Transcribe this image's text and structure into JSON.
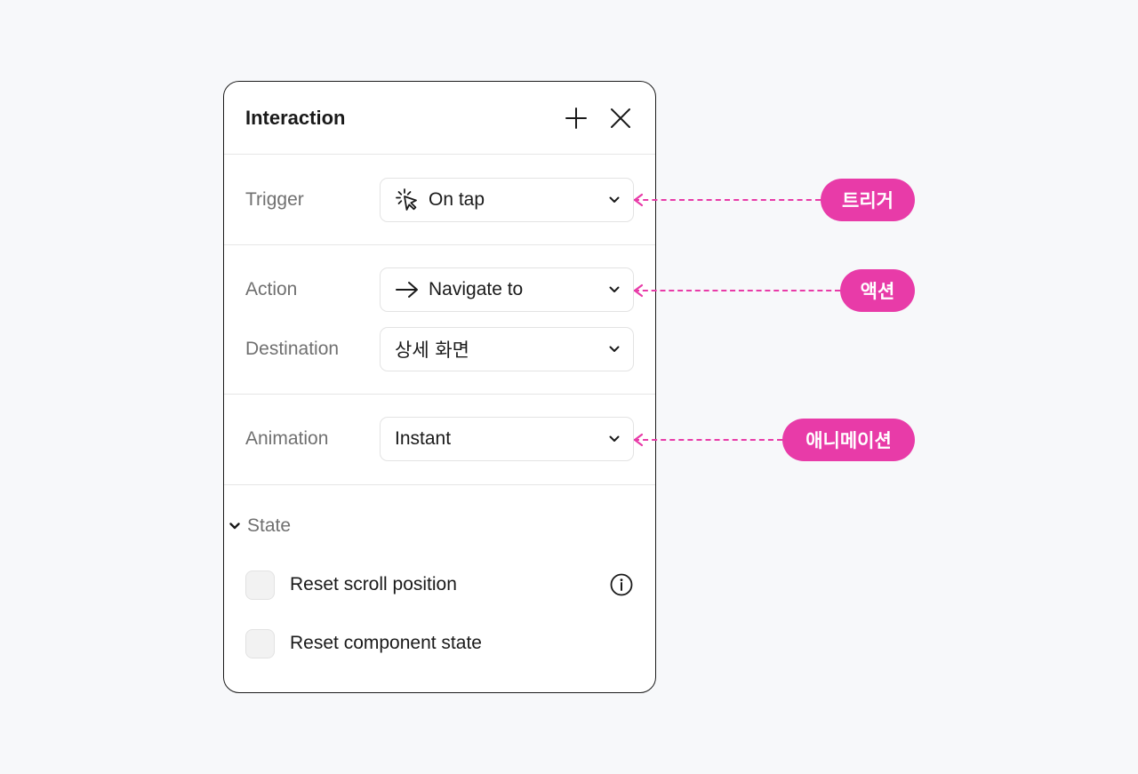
{
  "panel": {
    "title": "Interaction",
    "add_icon": "plus-icon",
    "close_icon": "close-icon"
  },
  "trigger": {
    "label": "Trigger",
    "value": "On tap",
    "icon": "tap-cursor-icon"
  },
  "action": {
    "label": "Action",
    "value": "Navigate to",
    "icon": "arrow-right-icon"
  },
  "destination": {
    "label": "Destination",
    "value": "상세 화면"
  },
  "animation": {
    "label": "Animation",
    "value": "Instant"
  },
  "state": {
    "label": "State",
    "expanded": true,
    "options": [
      {
        "label": "Reset scroll position",
        "checked": false,
        "has_info": true
      },
      {
        "label": "Reset component state",
        "checked": false,
        "has_info": false
      }
    ]
  },
  "callouts": {
    "trigger": "트리거",
    "action": "액션",
    "animation": "애니메이션"
  },
  "colors": {
    "accent": "#e83ba8",
    "background": "#f7f8fa",
    "panel_border": "#1a1a1a",
    "label": "#707070"
  }
}
